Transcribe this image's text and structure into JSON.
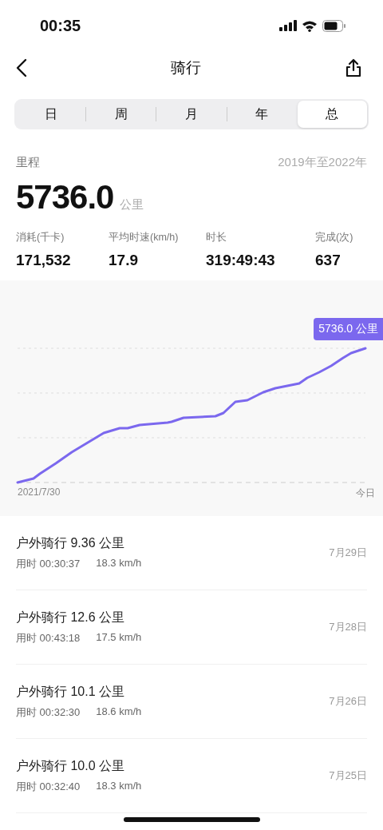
{
  "status_bar": {
    "time": "00:35"
  },
  "nav": {
    "title": "骑行"
  },
  "tabs": [
    {
      "label": "日",
      "selected": false
    },
    {
      "label": "周",
      "selected": false
    },
    {
      "label": "月",
      "selected": false
    },
    {
      "label": "年",
      "selected": false
    },
    {
      "label": "总",
      "selected": true
    }
  ],
  "summary": {
    "label": "里程",
    "range": "2019年至2022年",
    "value": "5736.0",
    "unit": "公里"
  },
  "stats": [
    {
      "label": "消耗(千卡)",
      "value": "171,532"
    },
    {
      "label": "平均时速(km/h)",
      "value": "17.9"
    },
    {
      "label": "时长",
      "value": "319:49:43"
    },
    {
      "label": "完成(次)",
      "value": "637"
    }
  ],
  "chart": {
    "callout": "5736.0 公里",
    "x_start_label": "2021/7/30",
    "x_end_label": "今日"
  },
  "records": [
    {
      "title": "户外骑行 9.36 公里",
      "duration": "用时 00:30:37",
      "speed": "18.3 km/h",
      "date": "7月29日"
    },
    {
      "title": "户外骑行 12.6 公里",
      "duration": "用时 00:43:18",
      "speed": "17.5 km/h",
      "date": "7月28日"
    },
    {
      "title": "户外骑行 10.1 公里",
      "duration": "用时 00:32:30",
      "speed": "18.6 km/h",
      "date": "7月26日"
    },
    {
      "title": "户外骑行 10.0 公里",
      "duration": "用时 00:32:40",
      "speed": "18.3 km/h",
      "date": "7月25日"
    }
  ]
}
